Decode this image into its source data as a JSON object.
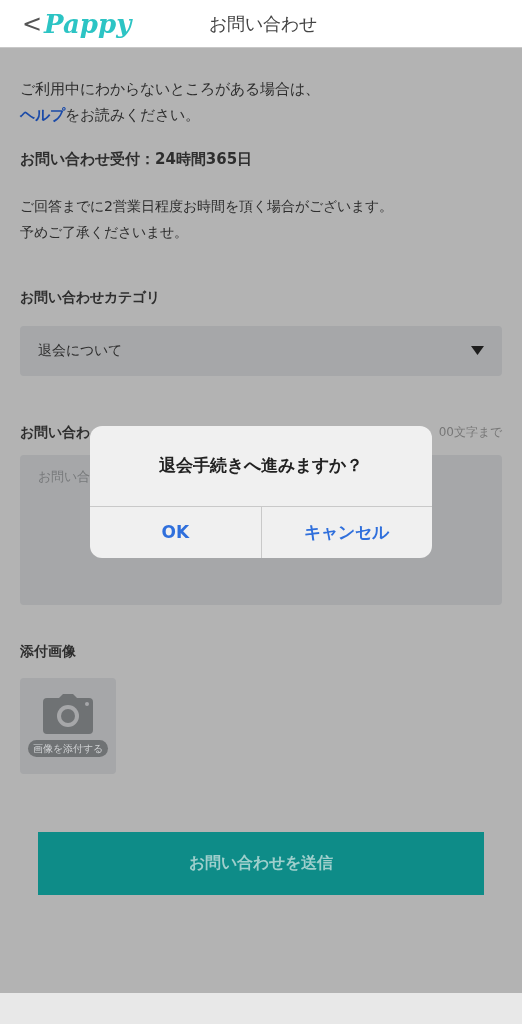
{
  "header": {
    "back": "<",
    "logo": "Pappy",
    "title": "お問い合わせ"
  },
  "intro": {
    "line1": "ご利用中にわからないところがある場合は、",
    "link": "ヘルプ",
    "line2_rest": "をお読みください。"
  },
  "hours": "お問い合わせ受付：24時間365日",
  "notice": [
    "ご回答までに2営業日程度お時間を頂く場合がございます。",
    "予めご了承くださいませ。"
  ],
  "category": {
    "label": "お問い合わせカテゴリ",
    "value": "退会について"
  },
  "content": {
    "label": "お問い合わ",
    "counter": "00文字まで",
    "placeholder": "お問い合"
  },
  "attachment": {
    "label": "添付画像",
    "button": "画像を添付する"
  },
  "submit": "お問い合わせを送信",
  "dialog": {
    "message": "退会手続きへ進みますか？",
    "buttons": [
      "OK",
      "キャンセル"
    ]
  }
}
